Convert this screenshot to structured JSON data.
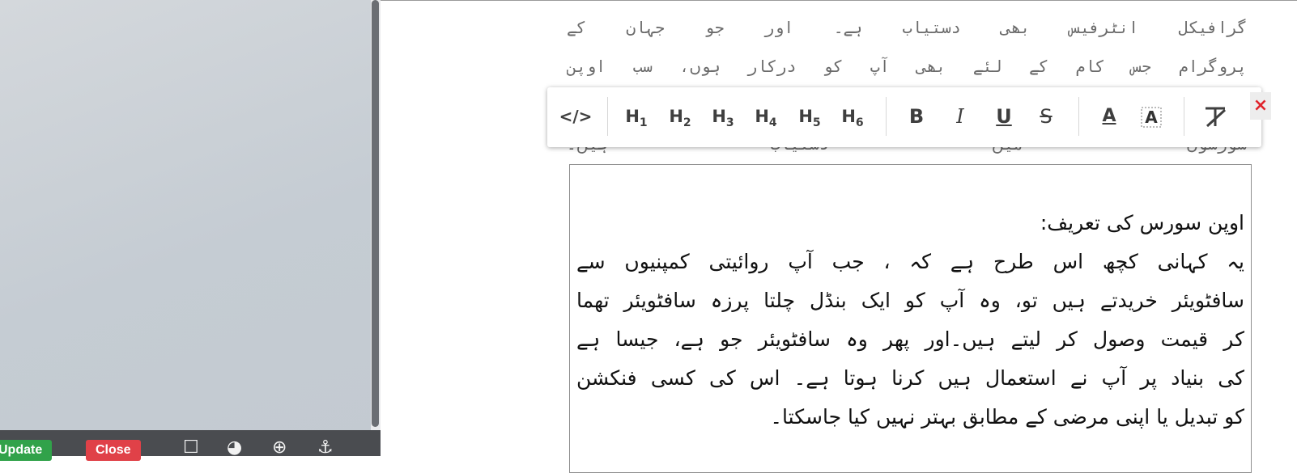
{
  "left_panel": {
    "update_label": "Update",
    "close_label": "Close"
  },
  "document": {
    "lines": [
      "گرافیکل انٹرفیس بھی دستیاب ہے۔ اور جو جہان کے",
      "پروگرام جس کام کے لئے بھی آپ کو درکار ہوں، سب اوپن",
      "سورسوں میں دستیاب ہیں۔"
    ]
  },
  "toolbar": {
    "code_icon": "</>",
    "headings": [
      "H1",
      "H2",
      "H3",
      "H4",
      "H5",
      "H6"
    ],
    "bold": "B",
    "italic": "I",
    "underline": "U",
    "strike": "S",
    "text_color": "A",
    "close_icon": "×"
  },
  "editor": {
    "heading": "اوپن سورس کی تعریف:",
    "lines": [
      "یہ کہانی کچھ اس طرح ہے کہ ، جب آپ روائیتی کمپنیوں سے",
      "سافٹویئر خریدتے ہیں تو، وہ آپ کو ایک بنڈل چلتا پرزہ سافٹویئر تھما",
      "کر قیمت وصول کر لیتے ہیں۔اور پھر وہ سافٹویئر جو ہے، جیسا ہے",
      "کی بنیاد پر آپ نے استعمال ہیں کرنا ہوتا ہے۔ اس کی کسی فنکشن",
      "کو تبدیل یا اپنی مرضی کے مطابق بہتر نہیں کیا جاسکتا۔"
    ]
  }
}
